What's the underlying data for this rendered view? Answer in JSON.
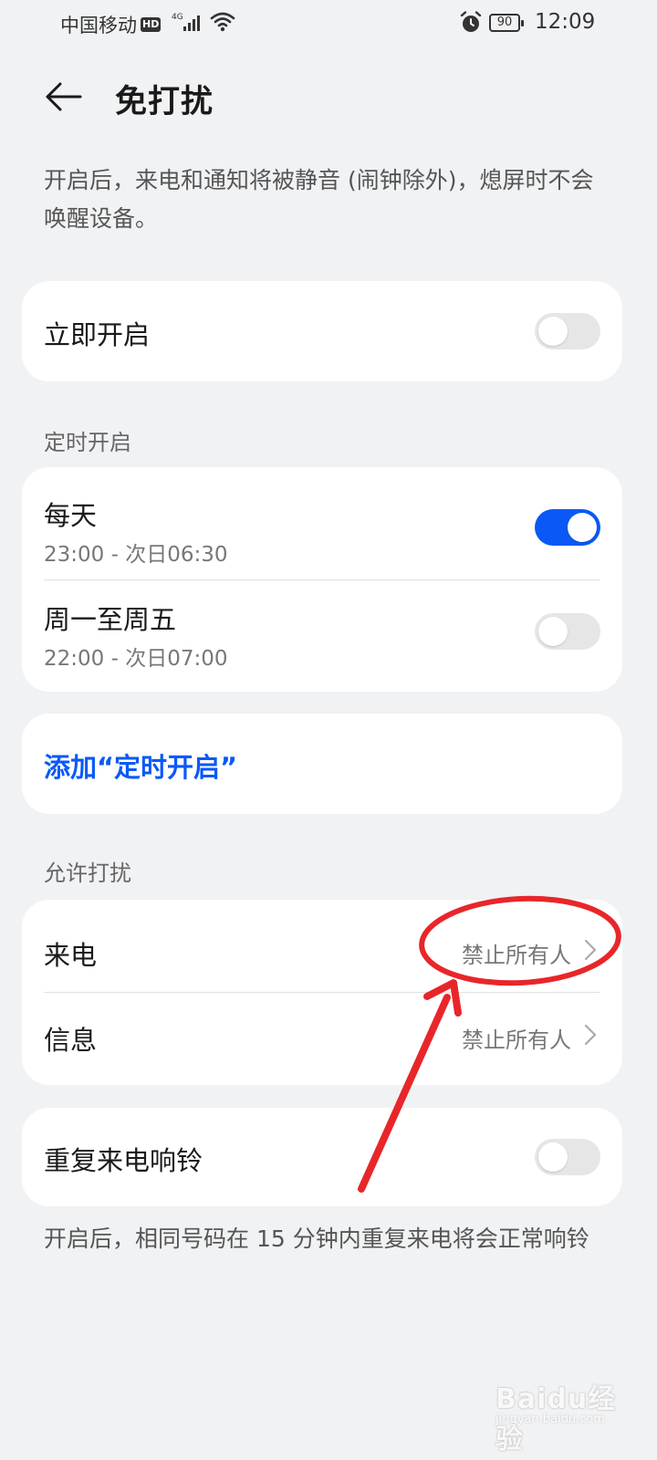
{
  "status_bar": {
    "carrier": "中国移动",
    "hd_badge": "HD",
    "network": "4G",
    "battery": "90",
    "time": "12:09"
  },
  "header": {
    "title": "免打扰"
  },
  "intro_text": "开启后，来电和通知将被静音 (闹钟除外)，熄屏时不会唤醒设备。",
  "immediate": {
    "label": "立即开启",
    "enabled": false
  },
  "scheduled": {
    "section_label": "定时开启",
    "items": [
      {
        "title": "每天",
        "time": "23:00 - 次日06:30",
        "enabled": true
      },
      {
        "title": "周一至周五",
        "time": "22:00 - 次日07:00",
        "enabled": false
      }
    ],
    "add_label": "添加“定时开启”"
  },
  "allow": {
    "section_label": "允许打扰",
    "items": [
      {
        "title": "来电",
        "value": "禁止所有人"
      },
      {
        "title": "信息",
        "value": "禁止所有人"
      }
    ]
  },
  "repeat_call": {
    "label": "重复来电响铃",
    "enabled": false,
    "note": "开启后，相同号码在 15 分钟内重复来电将会正常响铃"
  },
  "watermark": {
    "logo": "Baidu经验",
    "sub": "jingyan.baidu.com"
  },
  "colors": {
    "accent": "#0a59f7",
    "background": "#f1f2f4",
    "annotation": "#e8262a"
  }
}
